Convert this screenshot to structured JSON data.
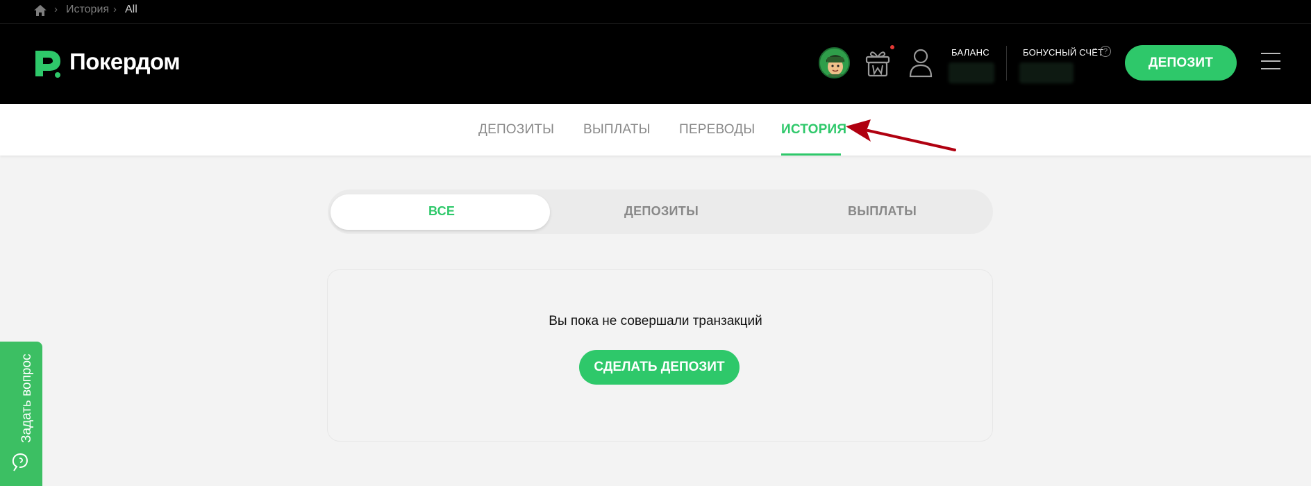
{
  "breadcrumb": {
    "items": [
      "История",
      "All"
    ]
  },
  "header": {
    "logo_text": "Покердом",
    "balance_label": "БАЛАНС",
    "bonus_label": "БОНУСНЫЙ СЧЁТ",
    "help_glyph": "?",
    "deposit_button": "ДЕПОЗИТ"
  },
  "tabs": [
    {
      "label": "ДЕПОЗИТЫ",
      "active": false
    },
    {
      "label": "ВЫПЛАТЫ",
      "active": false
    },
    {
      "label": "ПЕРЕВОДЫ",
      "active": false
    },
    {
      "label": "ИСТОРИЯ",
      "active": true
    }
  ],
  "filter": {
    "options": [
      "ВСЕ",
      "ДЕПОЗИТЫ",
      "ВЫПЛАТЫ"
    ],
    "selected": "ВСЕ"
  },
  "empty_state": {
    "message": "Вы пока не совершали транзакций",
    "button": "СДЕЛАТЬ ДЕПОЗИТ"
  },
  "feedback": {
    "label": "Задать вопрос"
  },
  "colors": {
    "accent": "#2ec86a",
    "header_bg": "#000000",
    "page_bg": "#f3f3f3",
    "annotation_arrow": "#b00010"
  }
}
